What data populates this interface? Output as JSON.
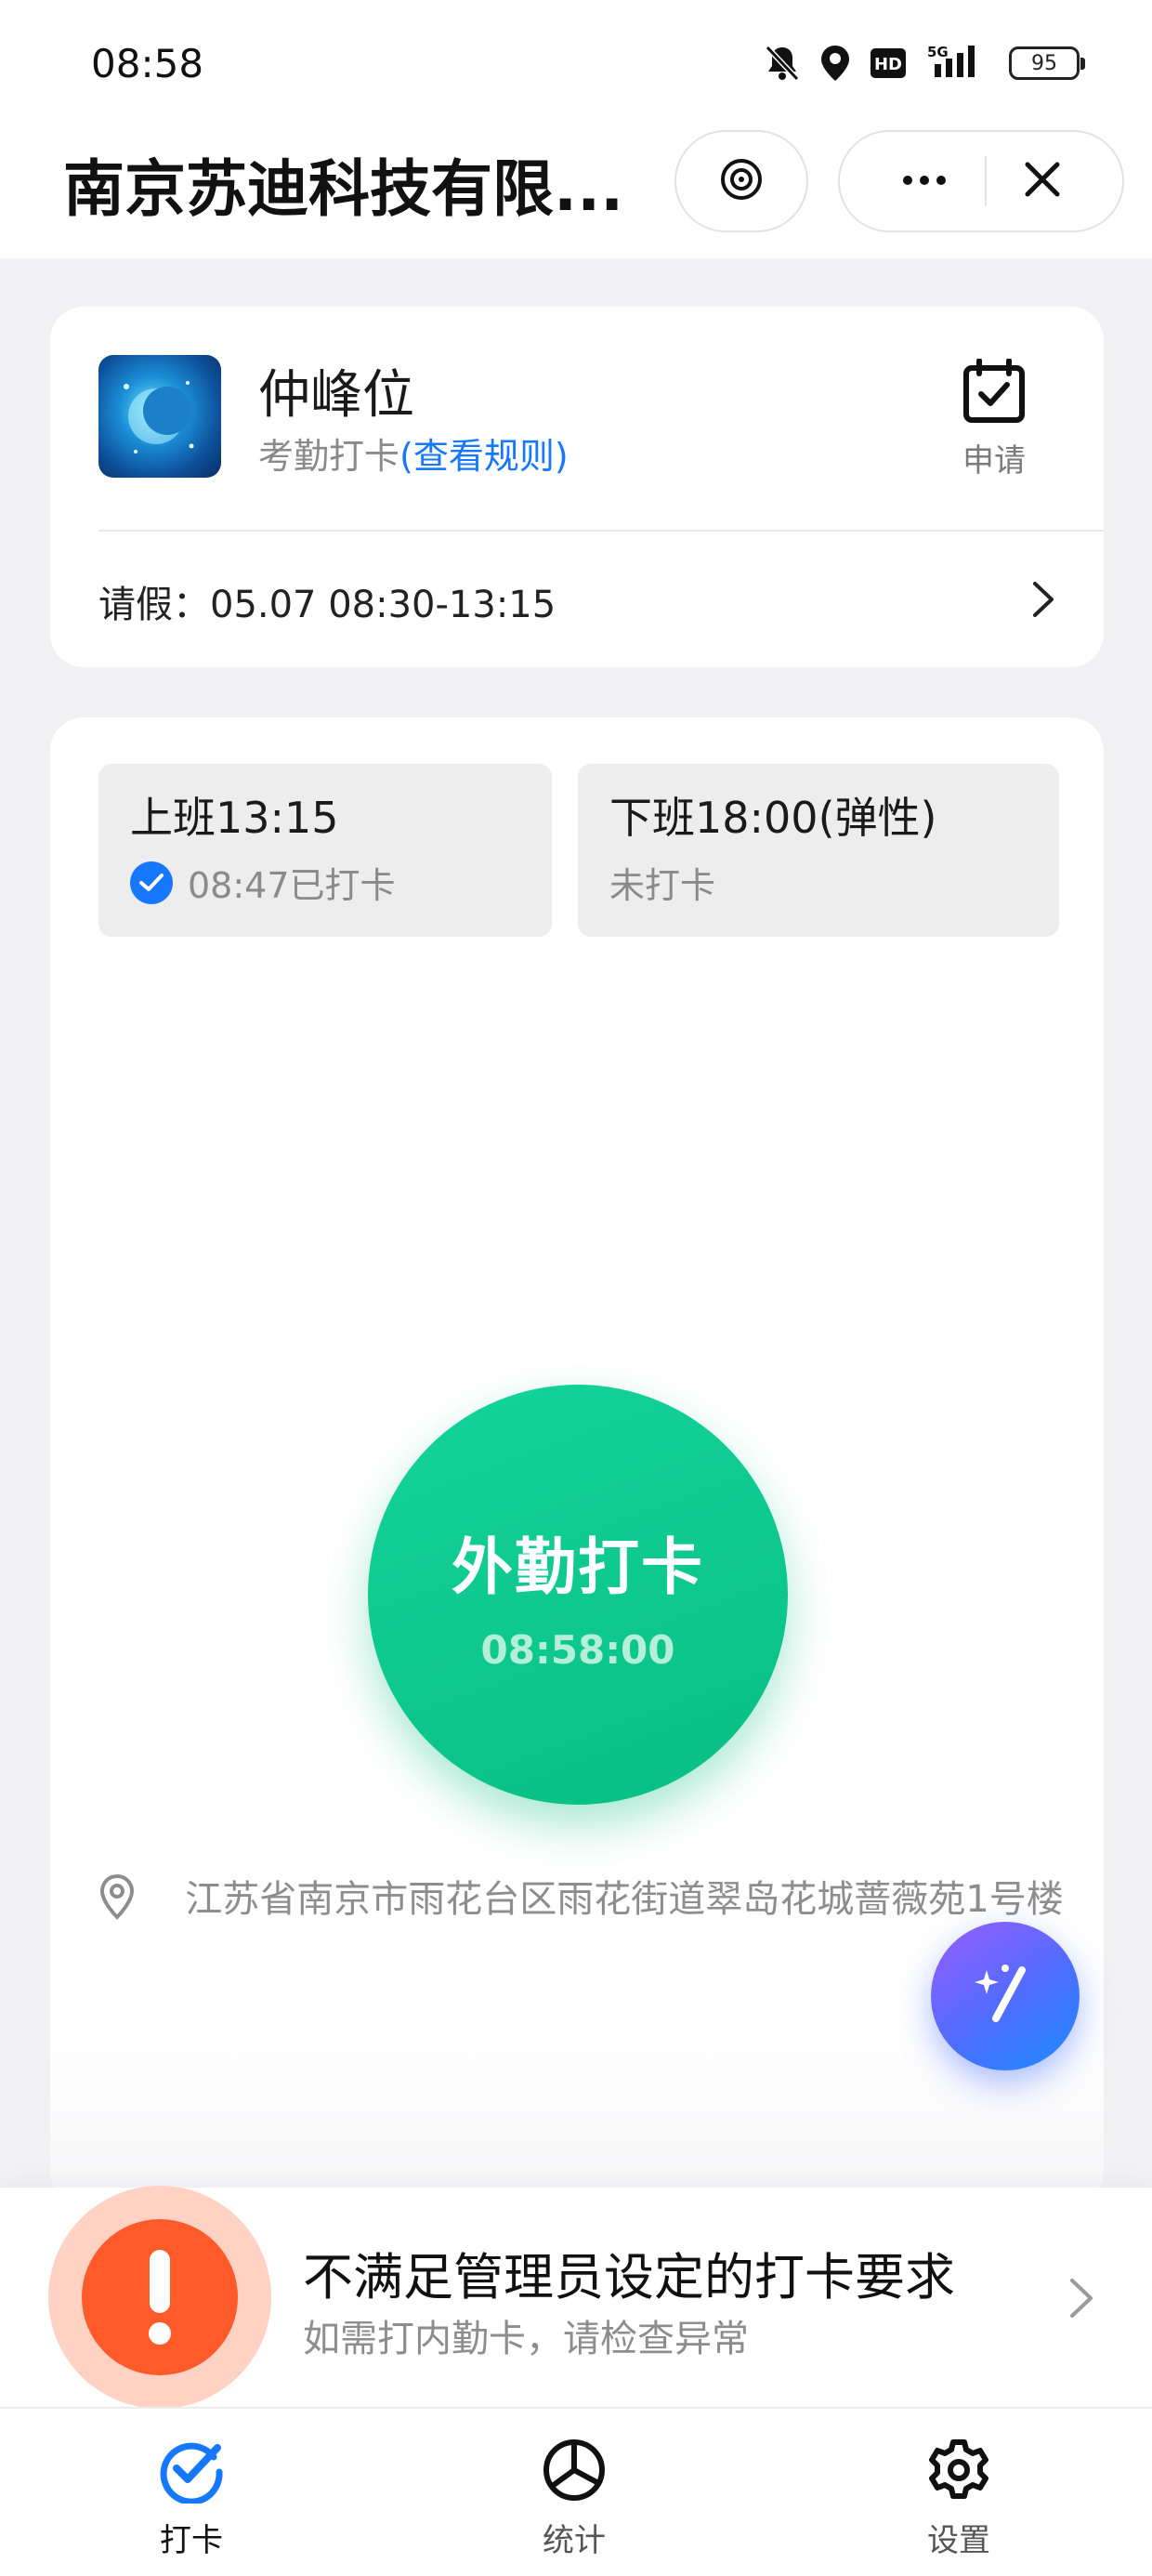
{
  "status_bar": {
    "time": "08:58",
    "network": "5G",
    "hd_badge": "HD",
    "battery_level": "95",
    "icons": [
      "mute-icon",
      "location-icon",
      "hd-icon",
      "signal-icon",
      "battery-icon"
    ]
  },
  "title_bar": {
    "title": "南京苏迪科技有限...",
    "icons": [
      "location-target-icon",
      "more-icon",
      "close-icon"
    ]
  },
  "profile_card": {
    "name": "仲峰位",
    "subtitle": "考勤打卡",
    "rules_link": "(查看规则)",
    "apply_label": "申请",
    "leave_text": "请假：05.07 08:30-13:15"
  },
  "shifts": [
    {
      "title": "上班13:15",
      "status": "08:47已打卡",
      "checked": true
    },
    {
      "title": "下班18:00(弹性)",
      "status": "未打卡",
      "checked": false
    }
  ],
  "punch": {
    "label": "外勤打卡",
    "time": "08:58:00",
    "accent_color": "#0fc88e"
  },
  "location": {
    "address": "江苏省南京市雨花台区雨花街道翠岛花城蔷薇苑1号楼"
  },
  "warning": {
    "title": "不满足管理员设定的打卡要求",
    "subtitle": "如需打内勤卡，请检查异常",
    "color": "#ff5a2a"
  },
  "tabs": [
    {
      "label": "打卡",
      "icon": "check-icon",
      "active": true
    },
    {
      "label": "统计",
      "icon": "chart-icon",
      "active": false
    },
    {
      "label": "设置",
      "icon": "gear-icon",
      "active": false
    }
  ]
}
